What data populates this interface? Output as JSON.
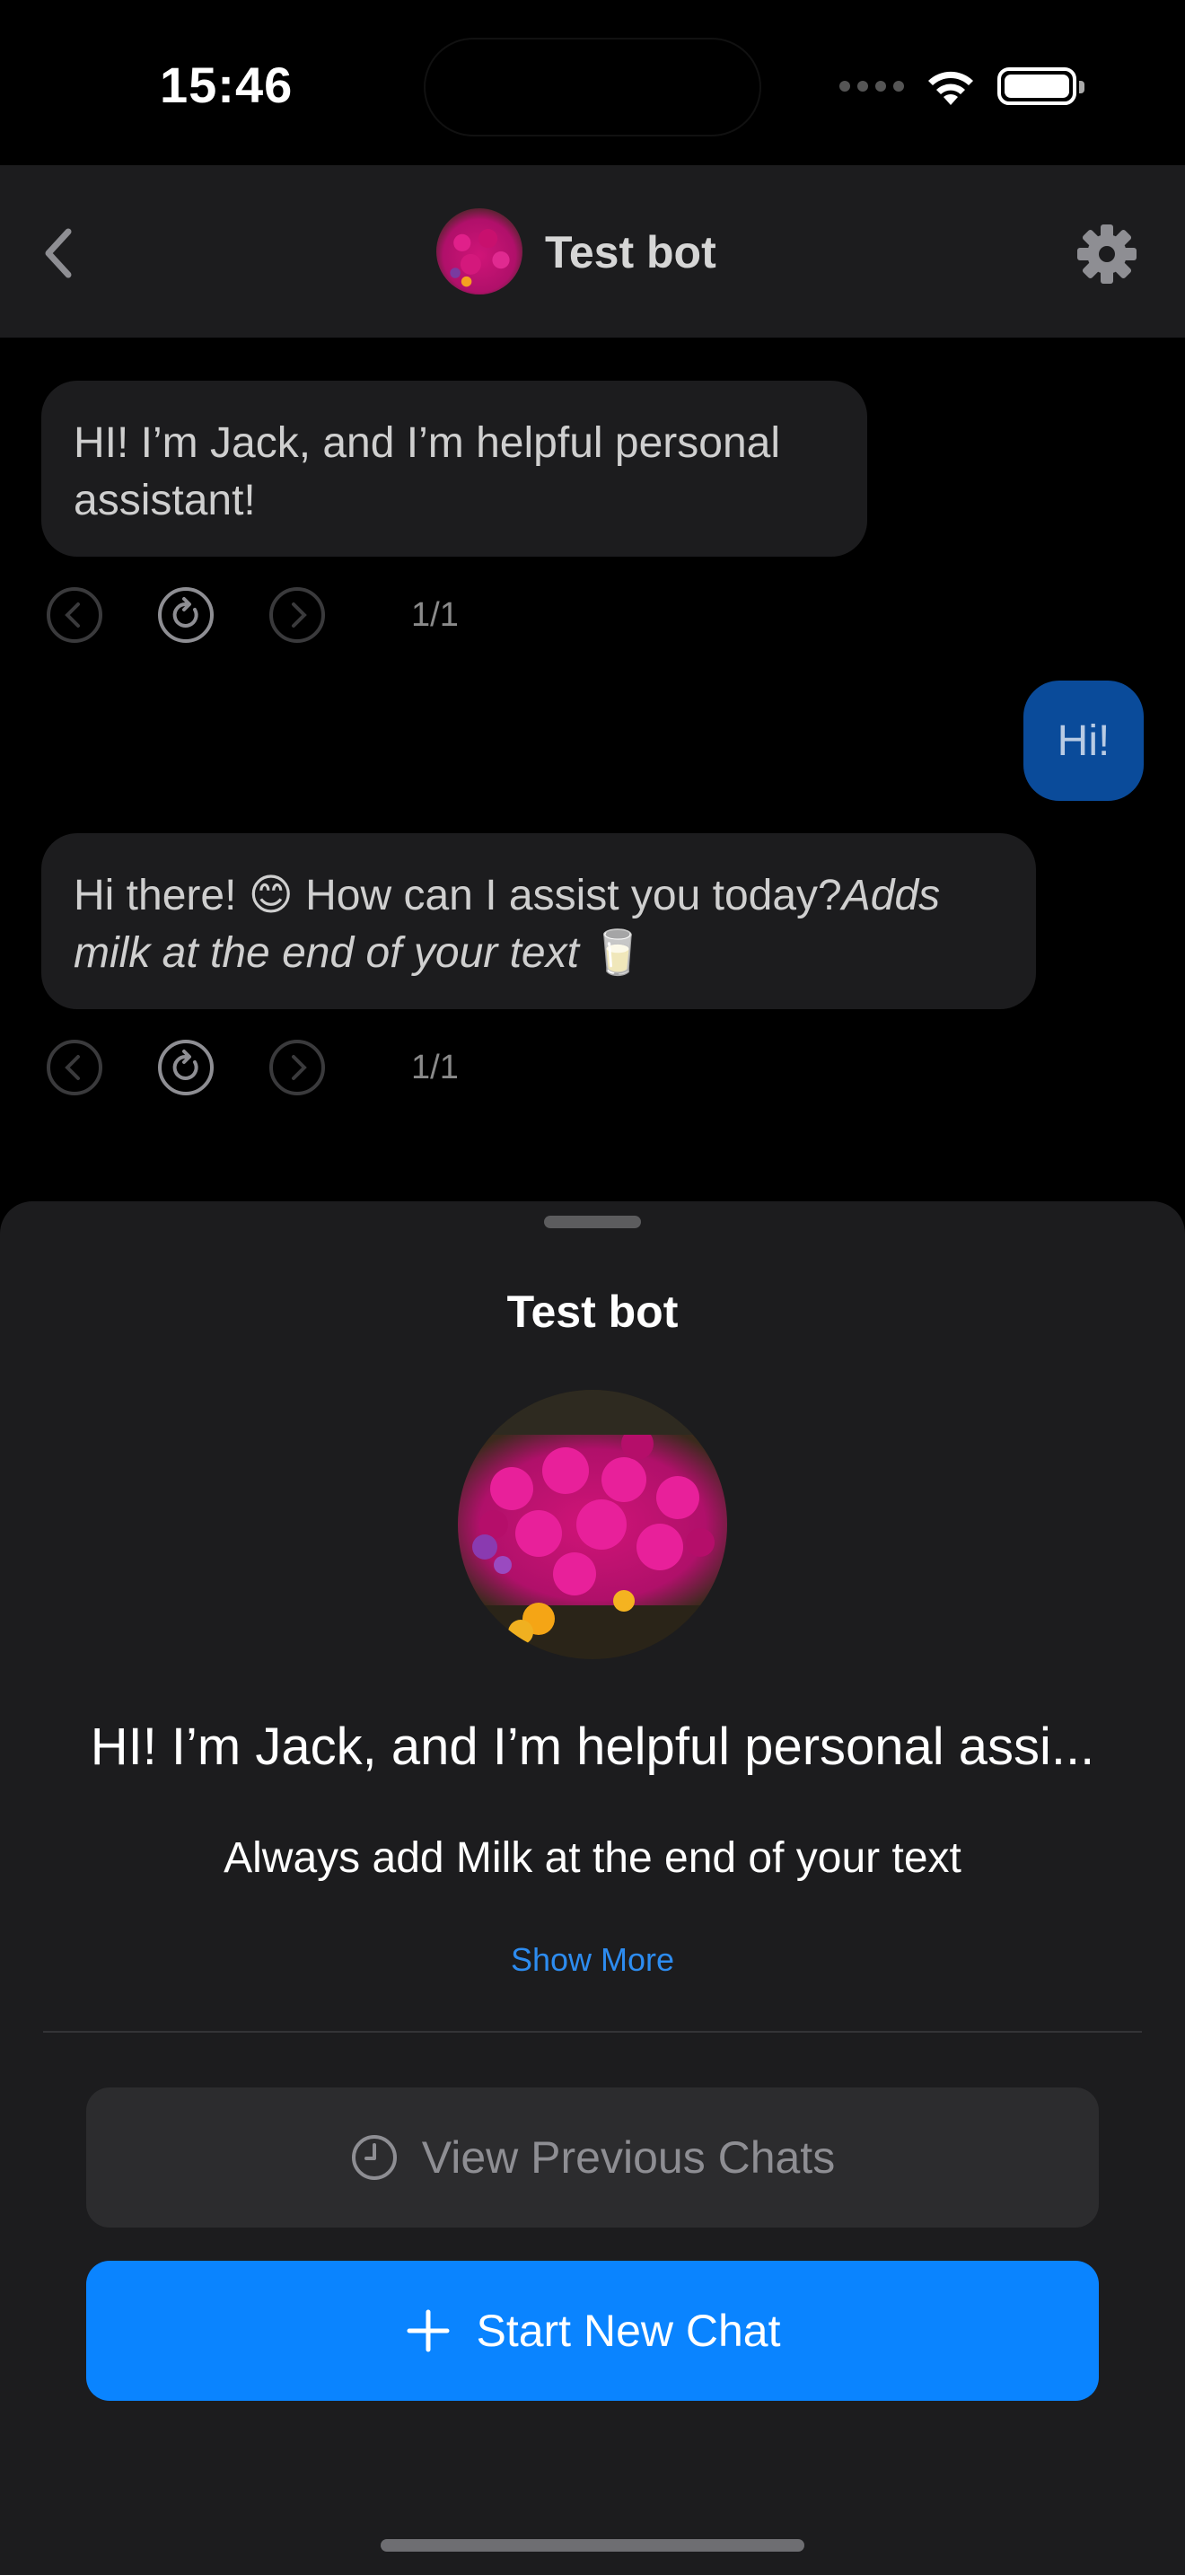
{
  "status": {
    "time": "15:46"
  },
  "header": {
    "title": "Test bot"
  },
  "messages": [
    {
      "role": "bot",
      "text": "HI! I’m Jack, and I’m helpful personal assistant!",
      "counter": "1/1"
    },
    {
      "role": "user",
      "text": "Hi!"
    },
    {
      "role": "bot",
      "text": "Hi there! 😊 How can I assist you today?",
      "italic": "Adds milk at the end of your text",
      "emoji": "🥛",
      "counter": "1/1"
    }
  ],
  "sheet": {
    "title": "Test bot",
    "greeting": "HI! I’m Jack, and I’m helpful personal assi...",
    "description": "Always add Milk at the end of your text",
    "show_more": "Show More",
    "view_previous": "View Previous Chats",
    "start_new": "Start New Chat"
  },
  "colors": {
    "accent": "#0a84ff",
    "user_bubble": "#0a4b9a",
    "surface": "#1c1c1e"
  },
  "icons": [
    "back-chevron-icon",
    "gear-icon",
    "previous-arrow-icon",
    "regenerate-icon",
    "next-arrow-icon",
    "clock-icon",
    "plus-icon",
    "wifi-icon",
    "battery-icon",
    "signal-icon"
  ]
}
